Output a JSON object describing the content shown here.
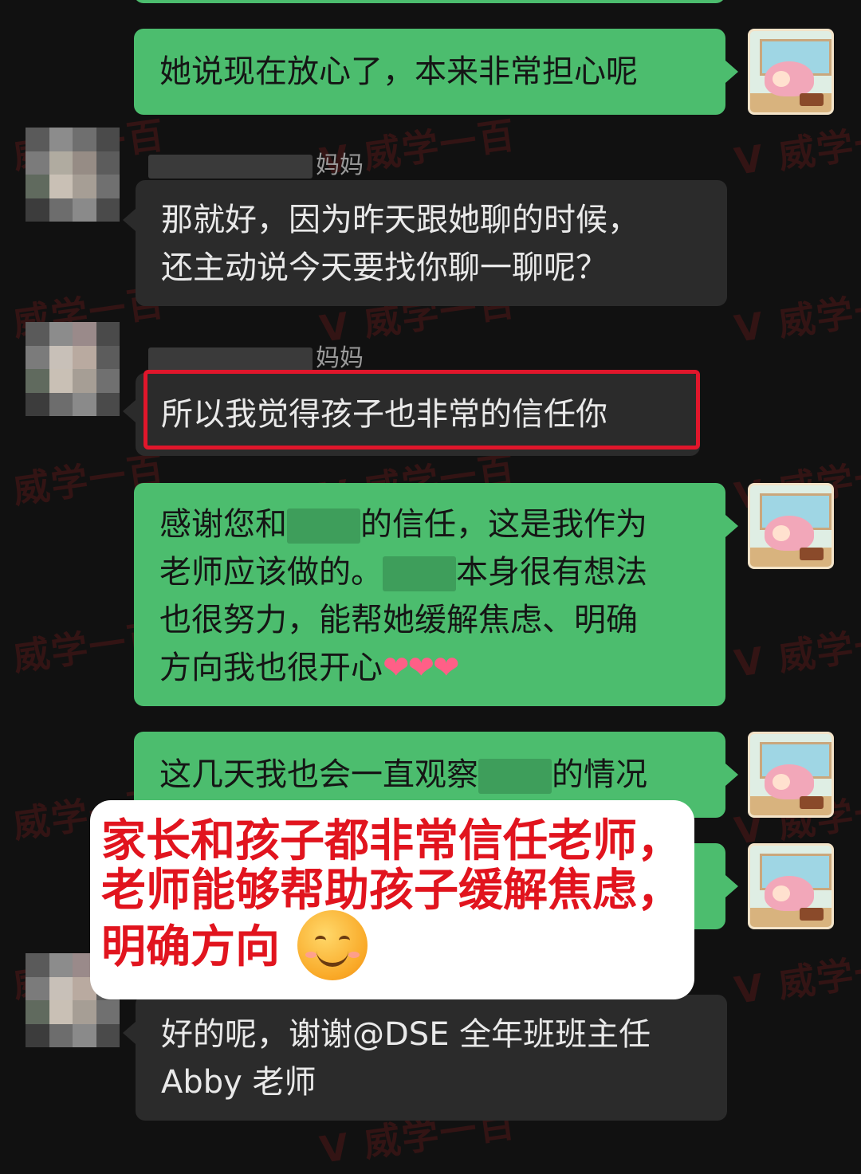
{
  "watermark_text": "V 威学一百",
  "messages": [
    {
      "id": "m1",
      "side": "out",
      "text": "她说现在放心了，本来非常担心呢"
    },
    {
      "id": "m2",
      "side": "in",
      "sender_suffix": "妈妈",
      "lines": [
        "那就好，因为昨天跟她聊的时候，",
        "还主动说今天要找你聊一聊呢？"
      ]
    },
    {
      "id": "m3",
      "side": "in",
      "sender_suffix": "妈妈",
      "text": "所以我觉得孩子也非常的信任你",
      "highlighted": true
    },
    {
      "id": "m4",
      "side": "out",
      "parts": [
        "感谢您和",
        "的信任，这是我作为",
        "老师应该做的。",
        "本身很有想法",
        "也很努力，能帮她缓解焦虑、明确",
        "方向我也很开心"
      ],
      "hearts": "❤❤❤"
    },
    {
      "id": "m5",
      "side": "out",
      "parts": [
        "这几天我也会一直观察",
        "的情况"
      ]
    },
    {
      "id": "m6",
      "side": "out"
    },
    {
      "id": "m7",
      "side": "in",
      "lines": [
        "好的呢，谢谢@DSE 全年班班主任",
        "Abby 老师"
      ]
    }
  ],
  "caption": {
    "lines": [
      "家长和孩子都非常信任老师，",
      "老师能够帮助孩子缓解焦虑，",
      "明确方向"
    ],
    "emoji": "smiling-face"
  },
  "colors": {
    "background": "#111111",
    "outgoing_bubble": "#4cbd6e",
    "incoming_bubble": "#2b2b2b",
    "highlight": "#e0162b",
    "caption_text": "#e1141e"
  }
}
